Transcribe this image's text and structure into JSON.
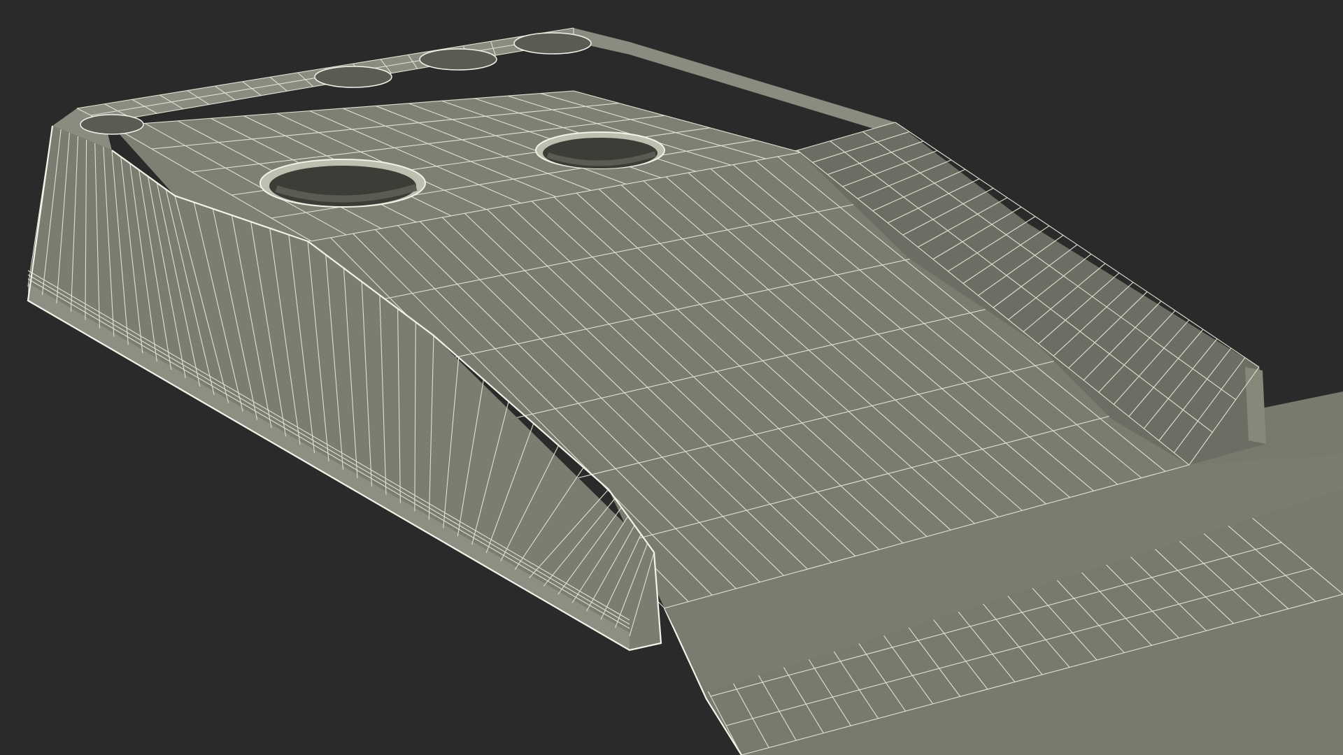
{
  "scene": {
    "background_color": "#2a2a2a",
    "surface_color": "#7a7b6f",
    "surface_top_color": "#808175",
    "surface_dark_color": "#5d5e54",
    "hole_color": "#3a3b35",
    "wire_color": "#e9ecdc"
  }
}
